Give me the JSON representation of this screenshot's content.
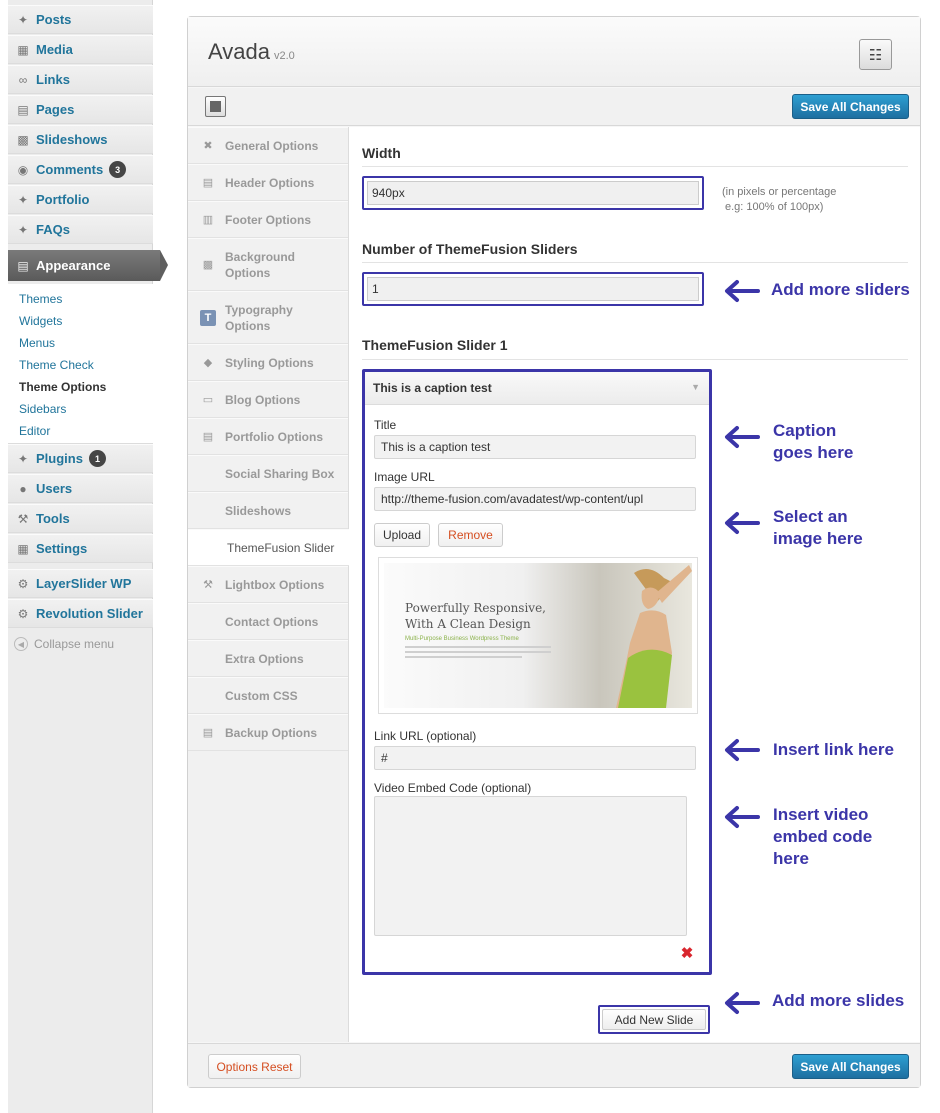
{
  "wp_menu": {
    "items": [
      {
        "label": "Posts",
        "icon": "pin-icon"
      },
      {
        "label": "Media",
        "icon": "media-icon"
      },
      {
        "label": "Links",
        "icon": "link-icon"
      },
      {
        "label": "Pages",
        "icon": "pages-icon"
      },
      {
        "label": "Slideshows",
        "icon": "slideshow-icon"
      },
      {
        "label": "Comments",
        "icon": "comment-icon",
        "badge": "3"
      },
      {
        "label": "Portfolio",
        "icon": "pin-icon"
      },
      {
        "label": "FAQs",
        "icon": "pin-icon"
      }
    ],
    "appearance": "Appearance",
    "appearance_sub": [
      "Themes",
      "Widgets",
      "Menus",
      "Theme Check",
      "Theme Options",
      "Sidebars",
      "Editor"
    ],
    "items_after": [
      {
        "label": "Plugins",
        "icon": "plugin-icon",
        "badge": "1"
      },
      {
        "label": "Users",
        "icon": "users-icon"
      },
      {
        "label": "Tools",
        "icon": "tools-icon"
      },
      {
        "label": "Settings",
        "icon": "settings-icon"
      }
    ],
    "plugins_menu": [
      {
        "label": "LayerSlider WP",
        "icon": "gear-icon"
      },
      {
        "label": "Revolution Slider",
        "icon": "gear-icon"
      }
    ],
    "collapse": "Collapse menu"
  },
  "panel": {
    "theme_name": "Avada",
    "theme_version": "v2.0",
    "save_label": "Save All Changes",
    "reset_label": "Options Reset"
  },
  "options_nav": [
    "General Options",
    "Header Options",
    "Footer Options",
    "Background Options",
    "Typography Options",
    "Styling Options",
    "Blog Options",
    "Portfolio Options",
    "Social Sharing Box",
    "Slideshows",
    "ThemeFusion Slider",
    "Lightbox Options",
    "Contact Options",
    "Extra Options",
    "Custom CSS",
    "Backup Options"
  ],
  "content": {
    "width_title": "Width",
    "width_value": "940px",
    "width_help_1": "(in pixels or percentage",
    "width_help_2": "e.g: 100% of 100px)",
    "sliders_title": "Number of ThemeFusion Sliders",
    "sliders_value": "1",
    "slider_section_title": "ThemeFusion Slider 1",
    "slide": {
      "header": "This is a caption test",
      "title_label": "Title",
      "title_value": "This is a caption test",
      "image_url_label": "Image URL",
      "image_url_value": "http://theme-fusion.com/avadatest/wp-content/upl",
      "upload_label": "Upload",
      "remove_label": "Remove",
      "preview_heading_1": "Powerfully Responsive,",
      "preview_heading_2": "With A Clean Design",
      "preview_sub": "Multi-Purpose Business Wordpress Theme",
      "link_label": "Link URL (optional)",
      "link_value": "#",
      "video_label": "Video Embed Code (optional)"
    },
    "add_slide_label": "Add New Slide"
  },
  "annotations": {
    "add_sliders": "Add more sliders",
    "caption_1": "Caption",
    "caption_2": "goes here",
    "image_1": "Select an",
    "image_2": "image here",
    "link": "Insert link here",
    "video_1": "Insert video",
    "video_2": "embed code",
    "video_3": "here",
    "add_slides": "Add more slides"
  },
  "colors": {
    "annotation": "#3b35a8",
    "wp_link": "#21759b",
    "save_button": "#2680b8",
    "remove_text": "#d54e21"
  }
}
